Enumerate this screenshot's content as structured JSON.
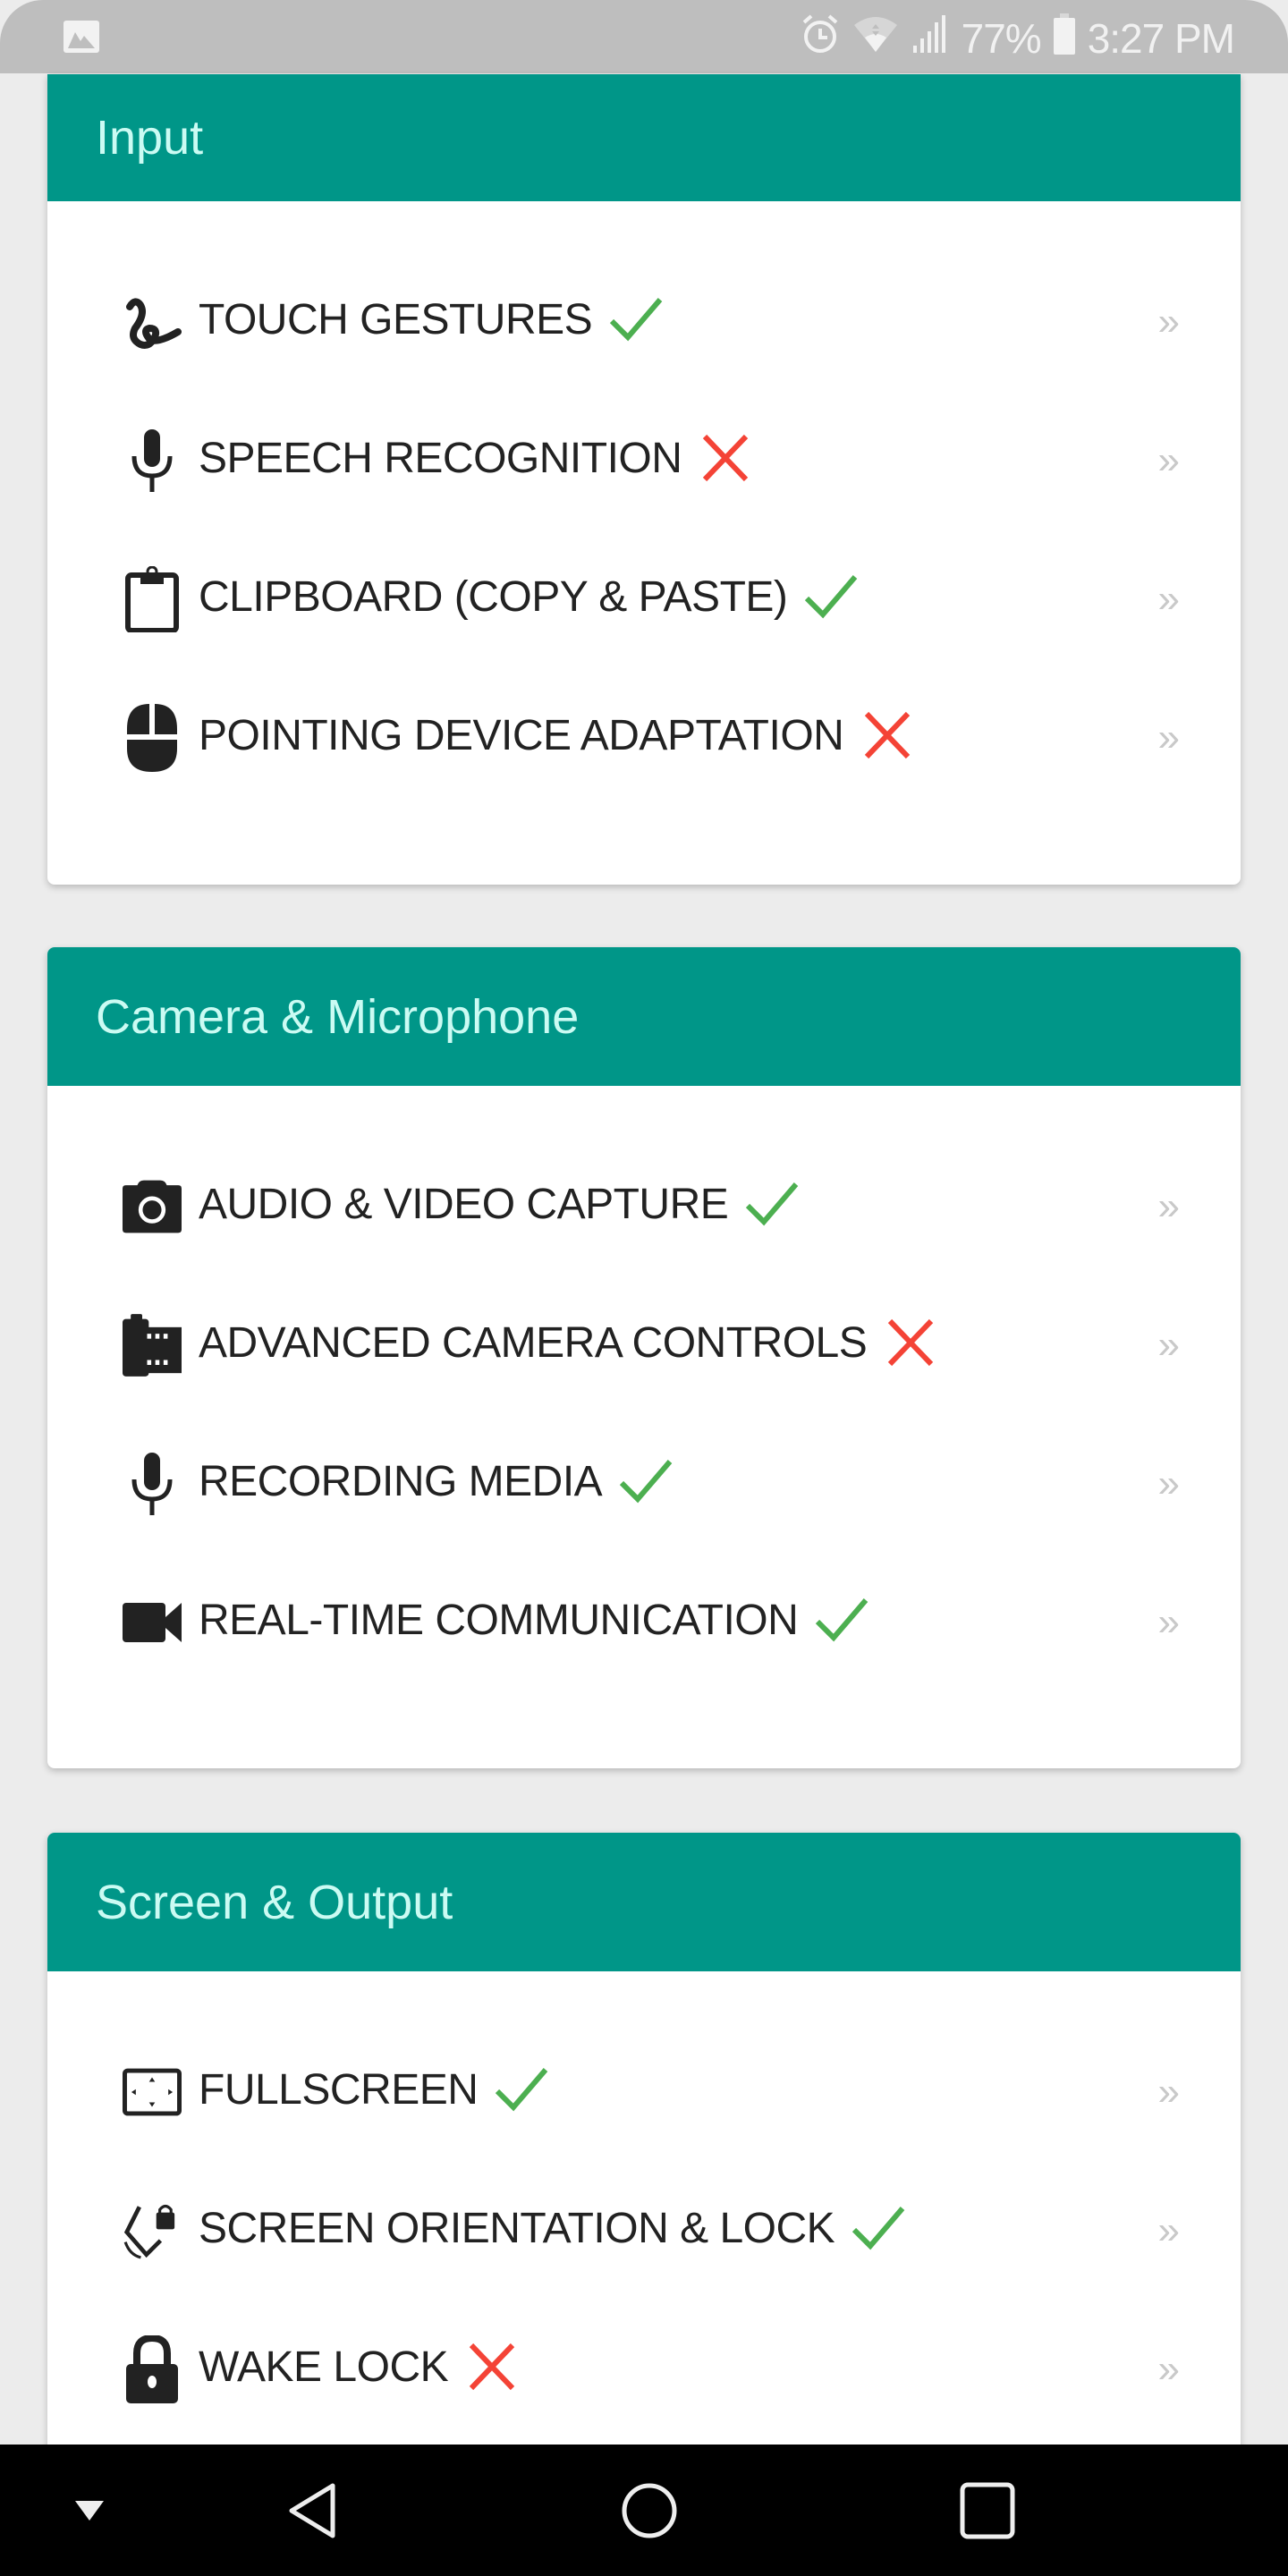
{
  "status_bar": {
    "left_icons": [
      "gallery-notification-icon"
    ],
    "right_icons": [
      "alarm-icon",
      "wifi-icon",
      "signal-icon"
    ],
    "battery_percent": "77%",
    "battery_level": 0.77,
    "time": "3:27 PM"
  },
  "colors": {
    "header": "#009688",
    "header_text": "#cbfbf3",
    "supported": "#4caf50",
    "unsupported": "#f44336",
    "chevron": "#c9c9c9",
    "background": "#ececec"
  },
  "sections": [
    {
      "title": "Input",
      "items": [
        {
          "label": "TOUCH GESTURES",
          "icon": "touch-gesture-icon",
          "supported": true,
          "chevron": "»"
        },
        {
          "label": "SPEECH RECOGNITION",
          "icon": "microphone-icon",
          "supported": false,
          "chevron": "»"
        },
        {
          "label": "CLIPBOARD (COPY & PASTE)",
          "icon": "clipboard-icon",
          "supported": true,
          "chevron": "»"
        },
        {
          "label": "POINTING DEVICE ADAPTATION",
          "icon": "mouse-icon",
          "supported": false,
          "chevron": "»"
        }
      ]
    },
    {
      "title": "Camera & Microphone",
      "items": [
        {
          "label": "AUDIO & VIDEO CAPTURE",
          "icon": "camera-icon",
          "supported": true,
          "chevron": "»"
        },
        {
          "label": "ADVANCED CAMERA CONTROLS",
          "icon": "film-roll-icon",
          "supported": false,
          "chevron": "»"
        },
        {
          "label": "RECORDING MEDIA",
          "icon": "microphone-icon",
          "supported": true,
          "chevron": "»"
        },
        {
          "label": "REAL-TIME COMMUNICATION",
          "icon": "video-camera-icon",
          "supported": true,
          "chevron": "»"
        }
      ]
    },
    {
      "title": "Screen & Output",
      "items": [
        {
          "label": "FULLSCREEN",
          "icon": "fullscreen-icon",
          "supported": true,
          "chevron": "»"
        },
        {
          "label": "SCREEN ORIENTATION & LOCK",
          "icon": "screen-rotation-lock-icon",
          "supported": true,
          "chevron": "»"
        },
        {
          "label": "WAKE LOCK",
          "icon": "padlock-icon",
          "supported": false,
          "chevron": "»"
        }
      ]
    }
  ],
  "nav_bar": {
    "buttons": [
      "hide-nav-icon",
      "back-icon",
      "home-icon",
      "recents-icon"
    ]
  }
}
